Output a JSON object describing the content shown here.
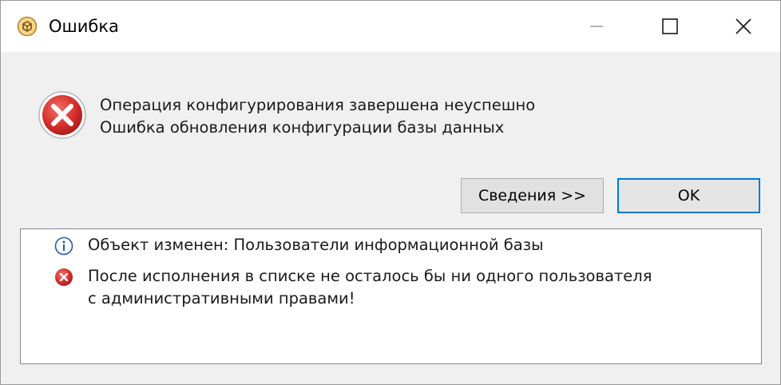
{
  "window": {
    "title": "Ошибка",
    "controls": {
      "minimize": "minimize-icon",
      "maximize": "maximize-icon",
      "close": "close-icon"
    }
  },
  "main": {
    "icon": "error-icon",
    "message_line1": "Операция конфигурирования завершена неуспешно",
    "message_line2": "Ошибка обновления конфигурации базы данных"
  },
  "buttons": {
    "details_label": "Сведения >>",
    "ok_label": "OK"
  },
  "log": {
    "items": [
      {
        "icon": "info-icon",
        "text": "Объект изменен: Пользователи информационной базы"
      },
      {
        "icon": "error-icon",
        "text_line1": "После исполнения в списке не осталось бы ни одного пользователя",
        "text_line2": "с административными правами!"
      }
    ]
  },
  "colors": {
    "error_red": "#d9302c",
    "info_blue": "#1f5fa8",
    "focus_blue": "#0078d7"
  }
}
